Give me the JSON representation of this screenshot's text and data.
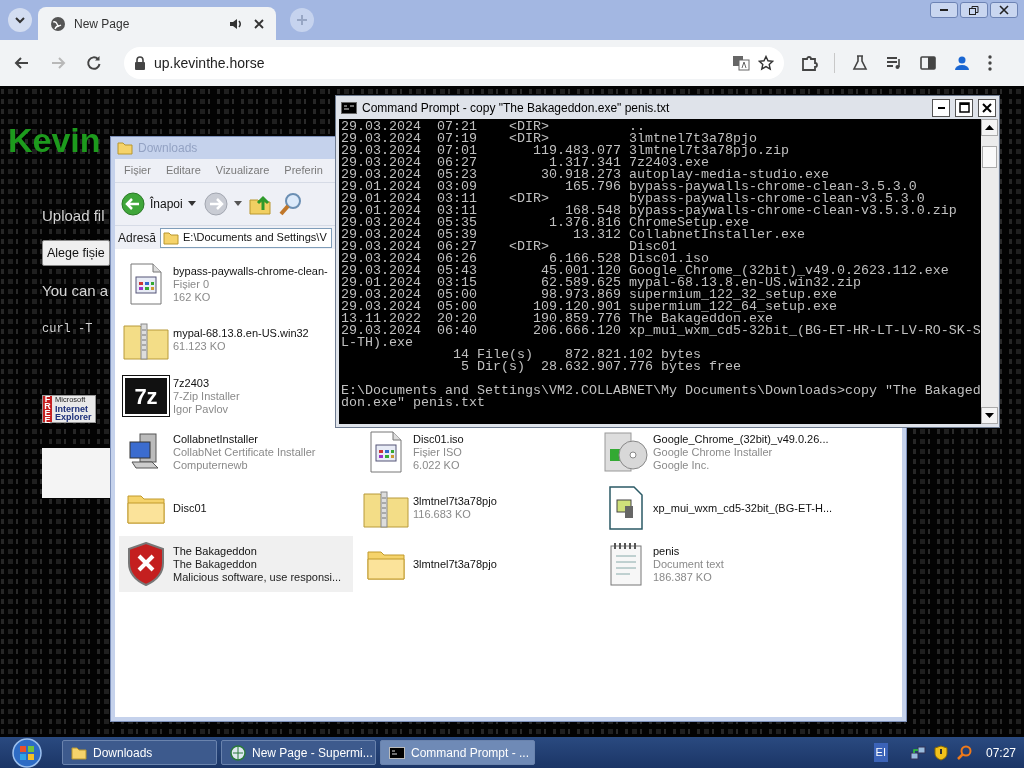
{
  "browser": {
    "tabs": [
      {
        "label": "New Page",
        "selected": true,
        "audio": true
      }
    ],
    "nav_buttons": [
      {
        "kind": "back",
        "disabled": false
      },
      {
        "kind": "forward",
        "disabled": true
      },
      {
        "kind": "reload",
        "disabled": false
      }
    ],
    "address": "up.kevinthe.horse"
  },
  "website": {
    "heading": "Kevin",
    "upload_label": "Upload fil",
    "choose_button": "Alege fișie",
    "note": "You can a",
    "command": "curl -T",
    "ie_badge": {
      "tag": "FREE",
      "lines": [
        "Microsoft",
        "Internet",
        "Explorer"
      ]
    }
  },
  "explorer": {
    "title": "Downloads",
    "active": false,
    "menu": [
      "Fișier",
      "Editare",
      "Vizualizare",
      "Preferin"
    ],
    "back_label": "Înapoi",
    "address_label": "Adresă",
    "address": "E:\\Documents and Settings\\V",
    "columns": [
      [
        {
          "kind": "generic",
          "selected": false,
          "lines": [
            "bypass-paywalls-chrome-clean-",
            "Fișier 0",
            "162 KO"
          ]
        },
        {
          "kind": "zip",
          "selected": false,
          "lines": [
            "mypal-68.13.8.en-US.win32",
            "61.123 KO"
          ]
        },
        {
          "kind": "logo",
          "logo_text": "7z",
          "selected": false,
          "lines": [
            "7z2403",
            "7-Zip Installer",
            "Igor Pavlov"
          ]
        },
        {
          "kind": "installer",
          "selected": false,
          "lines": [
            "CollabnetInstaller",
            "CollabNet Certificate Installer",
            "Computernewb"
          ]
        },
        {
          "kind": "folder",
          "selected": false,
          "lines": [
            "Disc01"
          ]
        },
        {
          "kind": "shield",
          "selected": true,
          "lines": [
            "The Bakageddon",
            "The Bakageddon",
            "Malicious software, use responsi..."
          ]
        }
      ],
      [
        {
          "kind": "generic",
          "selected": false,
          "lines": [
            "Disc01.iso",
            "Fișier ISO",
            "6.022 KO"
          ]
        },
        {
          "kind": "zip",
          "selected": false,
          "lines": [
            "3lmtnel7t3a78pjo",
            "116.683 KO"
          ]
        },
        {
          "kind": "folder",
          "selected": false,
          "lines": [
            "3lmtnel7t3a78pjo"
          ]
        }
      ],
      [
        {
          "kind": "disc",
          "selected": false,
          "lines": [
            "Google_Chrome_(32bit)_v49.0.26...",
            "Google Chrome Installer",
            "Google Inc."
          ]
        },
        {
          "kind": "media",
          "selected": false,
          "lines": [
            "xp_mui_wxm_cd5-32bit_(BG-ET-H..."
          ]
        },
        {
          "kind": "notepad",
          "selected": false,
          "lines": [
            "penis",
            "Document text",
            "186.387 KO"
          ]
        }
      ]
    ]
  },
  "console": {
    "title": "Command Prompt - copy \"The Bakageddon.exe\" penis.txt",
    "active": true,
    "listing": [
      "29.03.2024  07:21    <DIR>          ..",
      "29.03.2024  07:19    <DIR>          3lmtnel7t3a78pjo",
      "29.03.2024  07:01       119.483.077 3lmtnel7t3a78pjo.zip",
      "29.03.2024  06:27         1.317.341 7z2403.exe",
      "29.03.2024  05:23        30.918.273 autoplay-media-studio.exe",
      "29.01.2024  03:09           165.796 bypass-paywalls-chrome-clean-3.5.3.0",
      "29.01.2024  03:11    <DIR>          bypass-paywalls-chrome-clean-v3.5.3.0",
      "29.01.2024  03:11           168.548 bypass-paywalls-chrome-clean-v3.5.3.0.zip",
      "29.03.2024  05:35         1.376.816 ChromeSetup.exe",
      "29.03.2024  05:39            13.312 CollabnetInstaller.exe",
      "29.03.2024  06:27    <DIR>          Disc01",
      "29.03.2024  06:26         6.166.528 Disc01.iso",
      "29.03.2024  05:43        45.001.120 Google_Chrome_(32bit)_v49.0.2623.112.exe",
      "29.01.2024  03:15        62.589.625 mypal-68.13.8.en-US.win32.zip",
      "29.03.2024  05:00        98.973.869 supermium_122_32_setup.exe",
      "29.03.2024  05:00       109.120.901 supermium_122_64_setup.exe",
      "13.11.2022  20:20       190.859.776 The Bakageddon.exe",
      "29.03.2024  06:40       206.666.120 xp_mui_wxm_cd5-32bit_(BG-ET-HR-LT-LV-RO-SK-S",
      "L-TH).exe",
      "              14 File(s)    872.821.102 bytes",
      "               5 Dir(s)  28.632.907.776 bytes free"
    ],
    "prompt": [
      "E:\\Documents and Settings\\VM2.COLLABNET\\My Documents\\Downloads>copy \"The Bakaged",
      "don.exe\" penis.txt"
    ]
  },
  "taskbar": {
    "buttons": [
      {
        "kind": "folder",
        "label": "Downloads",
        "selected": false
      },
      {
        "kind": "browser",
        "label": "New Page - Supermi...",
        "selected": false
      },
      {
        "kind": "console",
        "label": "Command Prompt - ...",
        "selected": true
      }
    ],
    "language": "EI",
    "clock": "07:27"
  }
}
